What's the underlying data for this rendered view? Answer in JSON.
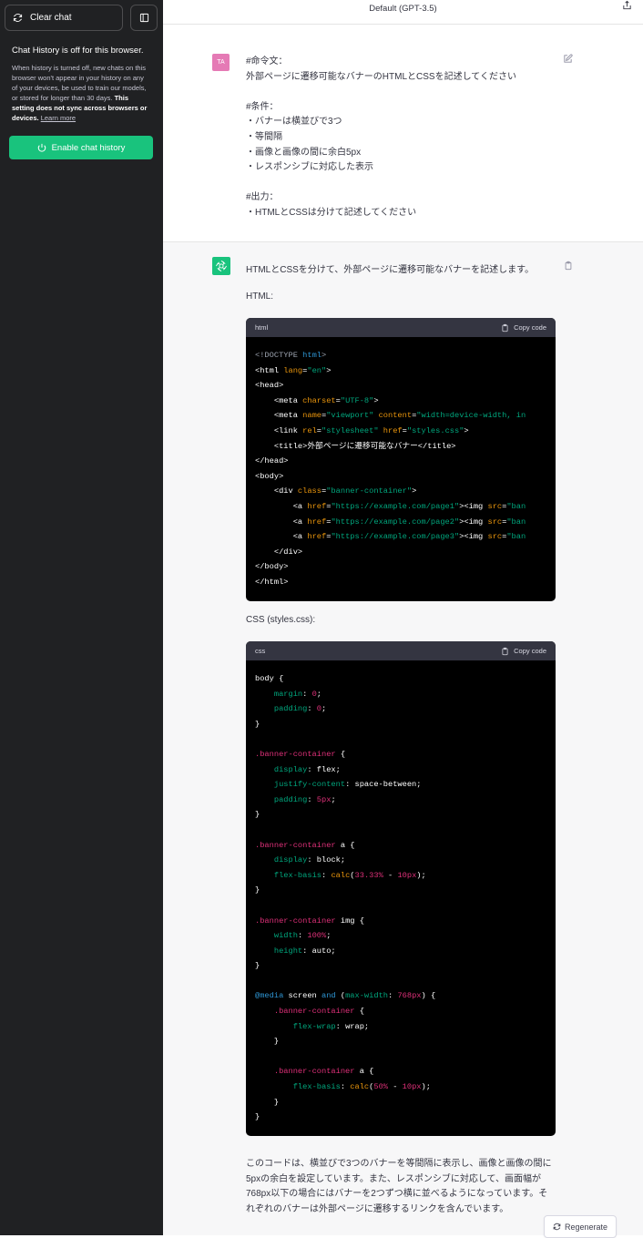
{
  "sidebar": {
    "clear_chat": "Clear chat",
    "history_title": "Chat History is off for this browser.",
    "history_desc": "When history is turned off, new chats on this browser won't appear in your history on any of your devices, be used to train our models, or stored for longer than 30 days.",
    "history_bold": "This setting does not sync across browsers or devices.",
    "learn_more": "Learn more",
    "enable_btn": "Enable chat history"
  },
  "header": {
    "model": "Default (GPT-3.5)"
  },
  "user": {
    "avatar": "TA",
    "message": "#命令文：\n外部ページに遷移可能なバナーのHTMLとCSSを記述してください\n\n#条件：\n・バナーは横並びで3つ\n・等間隔\n・画像と画像の間に余白5px\n・レスポンシブに対応した表示\n\n#出力：\n・HTMLとCSSは分けて記述してください"
  },
  "assistant": {
    "intro": "HTMLとCSSを分けて、外部ページに遷移可能なバナーを記述します。",
    "html_label": "HTML:",
    "css_label": "CSS (styles.css):",
    "html_lang": "html",
    "css_lang": "css",
    "copy_code": "Copy code",
    "summary": "このコードは、横並びで3つのバナーを等間隔に表示し、画像と画像の間に5pxの余白を設定しています。また、レスポンシブに対応して、画面幅が768px以下の場合にはバナーを2つずつ横に並べるようになっています。それぞれのバナーは外部ページに遷移するリンクを含んでいます。",
    "regenerate": "Regenerate"
  },
  "icons": {
    "clear": "refresh-icon",
    "sidebar_toggle": "sidebar-toggle-icon",
    "power": "power-icon",
    "share": "share-icon",
    "edit": "edit-icon",
    "clipboard": "clipboard-icon",
    "openai": "openai-logo-icon"
  },
  "colors": {
    "accent": "#19c37d",
    "sidebar": "#202123",
    "user_avatar": "#e57ab5"
  }
}
